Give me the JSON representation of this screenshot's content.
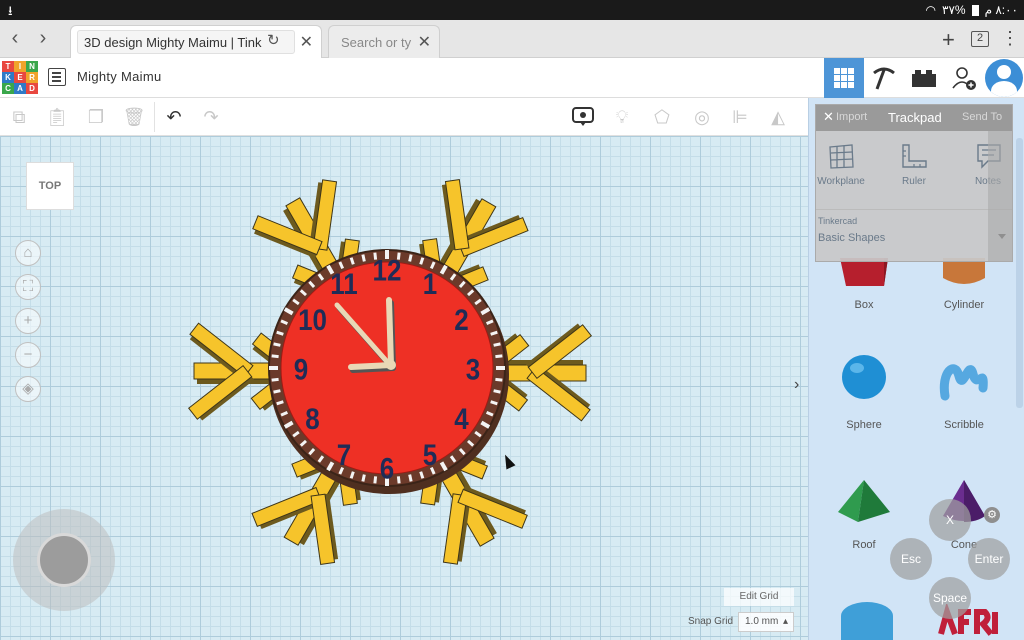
{
  "status_bar": {
    "battery": "٣٧%",
    "time": "٨:٠٠ م"
  },
  "browser": {
    "active_tab_title": "3D design Mighty Maimu | Tink",
    "inactive_tab_title": "Search or ty",
    "tab_count": "2"
  },
  "app": {
    "design_name": "Mighty Maimu",
    "logo_letters": [
      "T",
      "I",
      "N",
      "K",
      "E",
      "R",
      "C",
      "A",
      "D"
    ],
    "logo_colors": [
      "#e8473f",
      "#f0a32a",
      "#3aa74b",
      "#2f7ac7",
      "#e8473f",
      "#f0a32a",
      "#3aa74b",
      "#2f7ac7",
      "#e8473f"
    ],
    "accent": "#4d95d7"
  },
  "workplane": {
    "view_cube_label": "TOP",
    "edit_grid_label": "Edit Grid",
    "snap_grid_label": "Snap Grid",
    "snap_grid_value": "1.0 mm",
    "clock_numbers": [
      "12",
      "1",
      "2",
      "3",
      "4",
      "5",
      "6",
      "7",
      "8",
      "9",
      "10",
      "11"
    ],
    "clock_face_color": "#ee3025",
    "snowflake_color": "#f6c42b"
  },
  "trackpad": {
    "title": "Trackpad",
    "import_label": "Import",
    "send_to_label": "Send To",
    "items": [
      {
        "label": "Workplane"
      },
      {
        "label": "Ruler"
      },
      {
        "label": "Notes"
      }
    ],
    "library_source": "Tinkercad",
    "library_name": "Basic Shapes"
  },
  "shapes": {
    "box": "Box",
    "cylinder": "Cylinder",
    "sphere": "Sphere",
    "scribble": "Scribble",
    "roof": "Roof",
    "cone": "Cone"
  },
  "keys": {
    "x": "X",
    "esc": "Esc",
    "enter": "Enter",
    "space": "Space"
  }
}
